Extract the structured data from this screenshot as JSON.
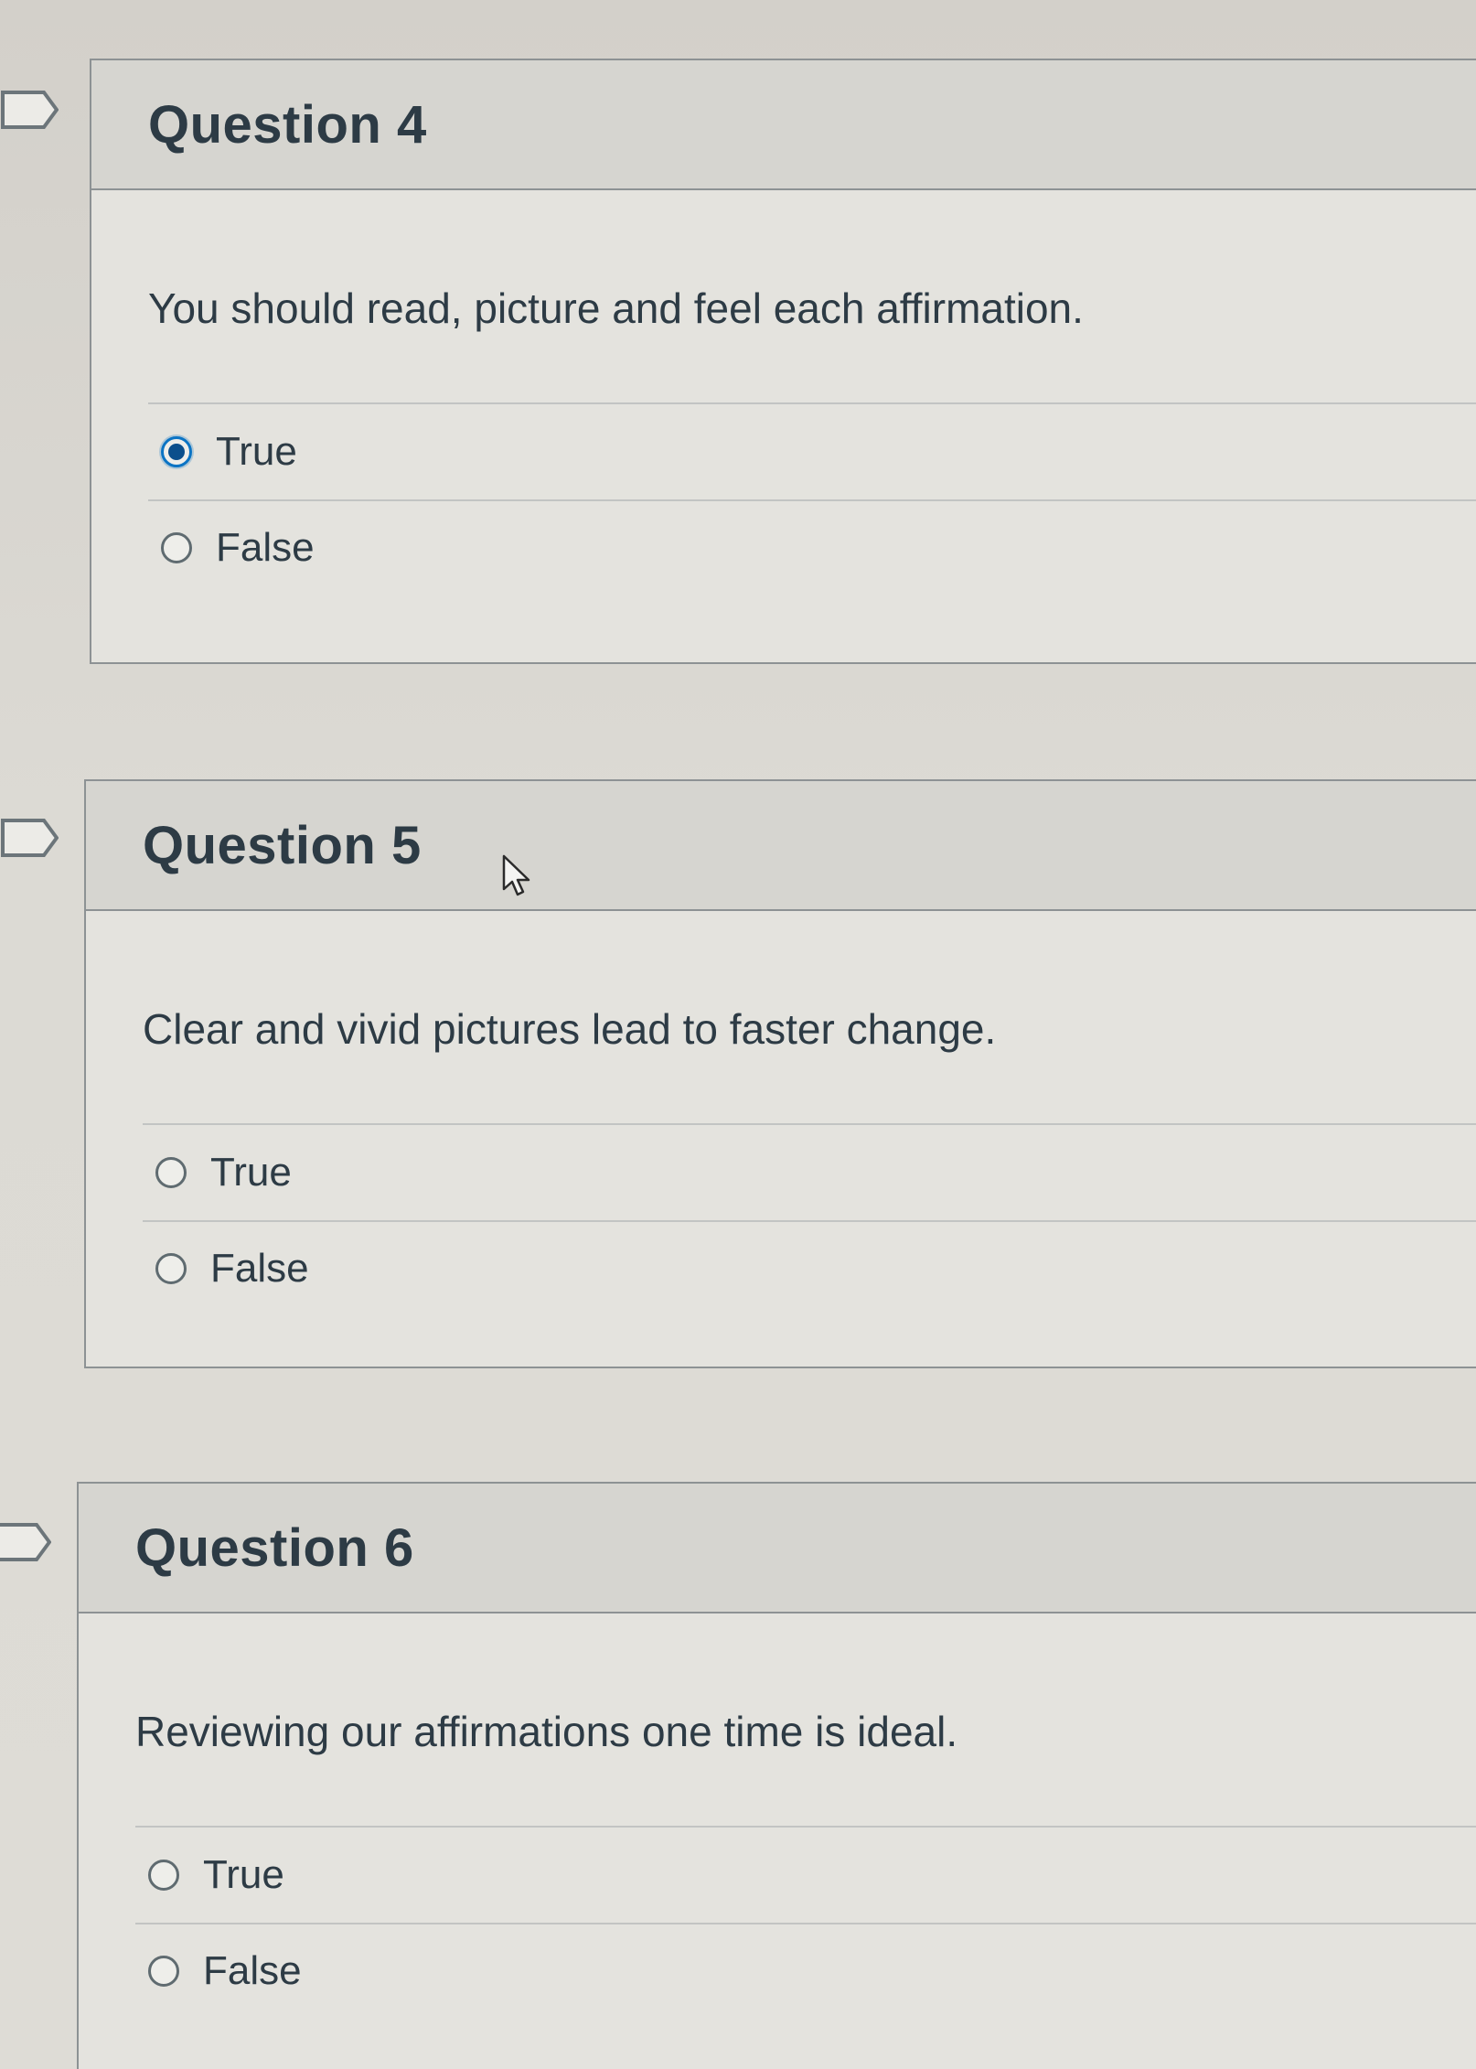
{
  "questions": [
    {
      "title": "Question 4",
      "text": "You should read, picture and feel each affirmation.",
      "answers": [
        {
          "label": "True",
          "selected": true
        },
        {
          "label": "False",
          "selected": false
        }
      ]
    },
    {
      "title": "Question 5",
      "text": "Clear and vivid pictures lead to faster change.",
      "answers": [
        {
          "label": "True",
          "selected": false
        },
        {
          "label": "False",
          "selected": false
        }
      ]
    },
    {
      "title": "Question 6",
      "text": "Reviewing our affirmations one time is ideal.",
      "answers": [
        {
          "label": "True",
          "selected": false
        },
        {
          "label": "False",
          "selected": false
        }
      ]
    }
  ],
  "colors": {
    "text": "#2d3b45",
    "selected_radio": "#0b74c4",
    "border": "#8d9294"
  },
  "icons": {
    "flag": "bookmark-flag-icon",
    "cursor": "mouse-pointer-icon"
  }
}
